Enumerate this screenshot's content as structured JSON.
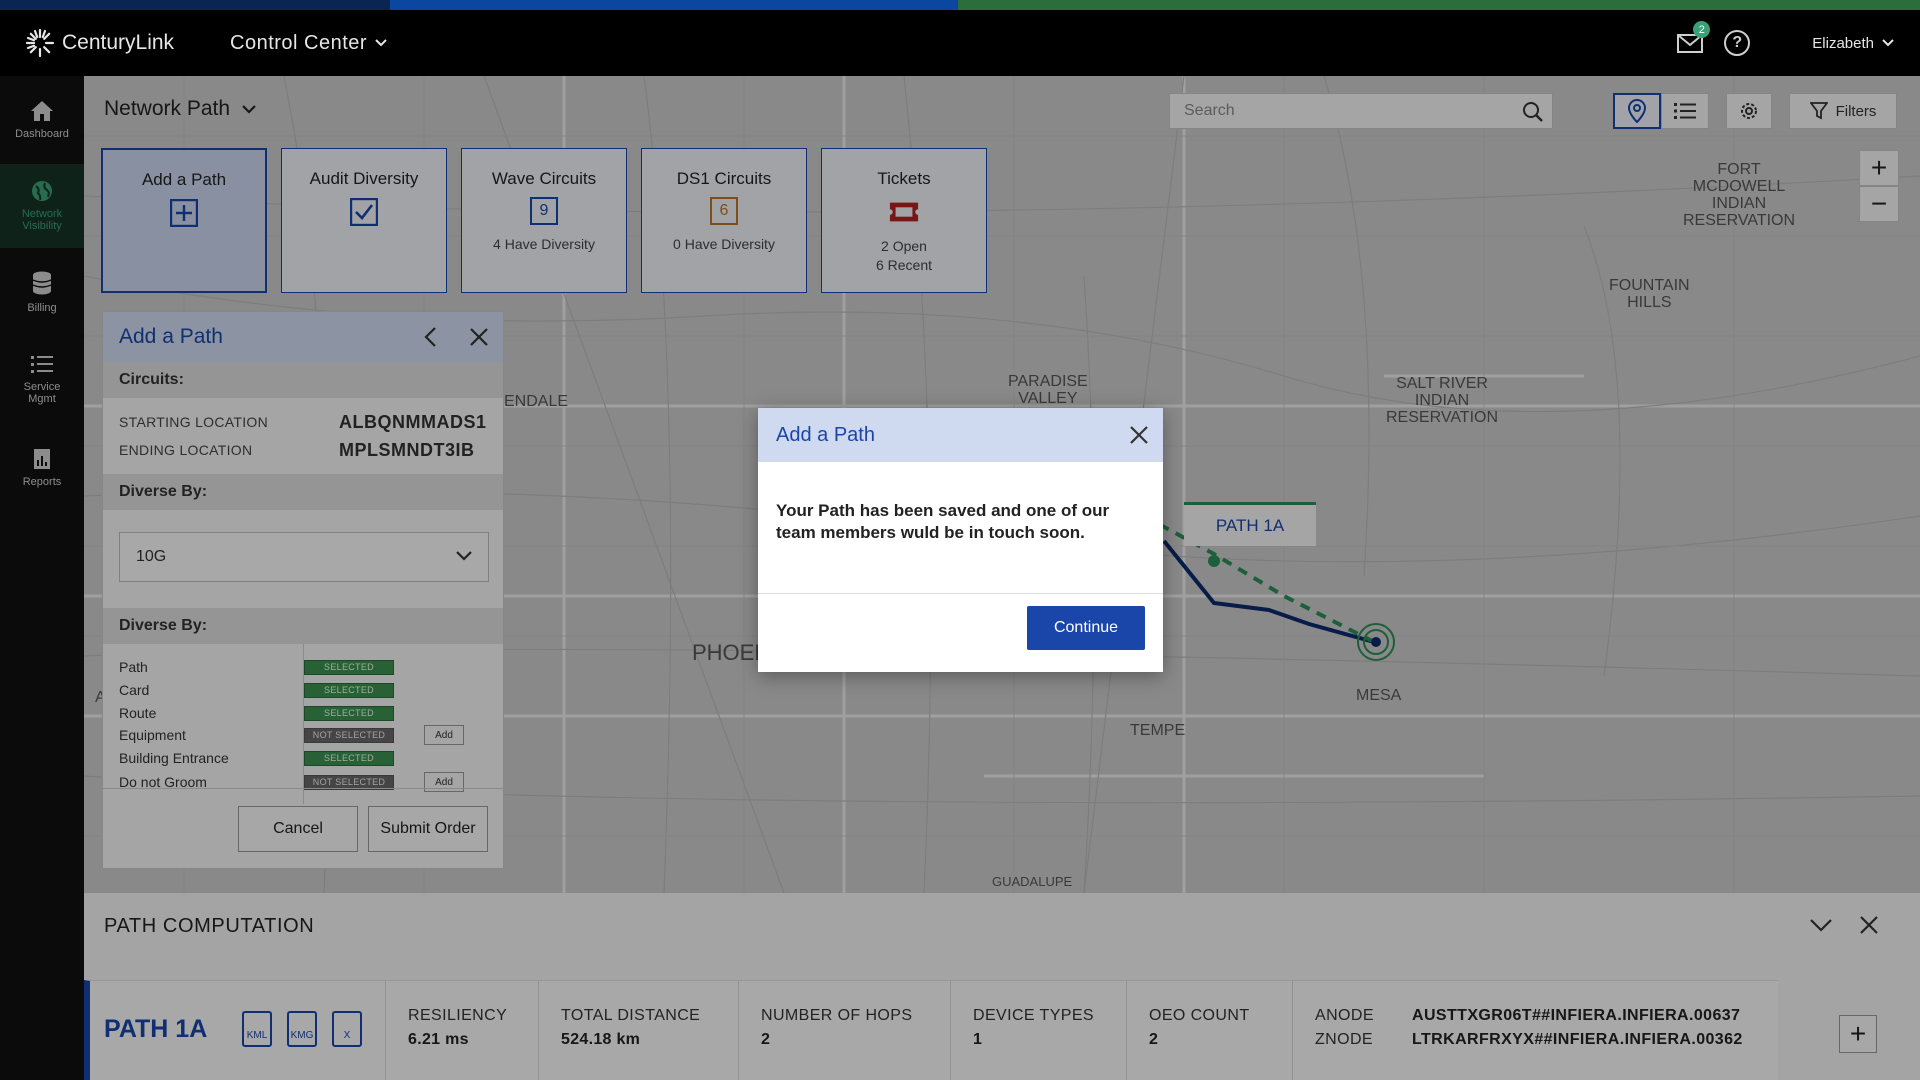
{
  "colors": {
    "brand_blue": "#1946a8",
    "brand_green": "#3aa077",
    "stripe_navy": "#0a2552",
    "stripe_blue": "#0b46a0",
    "stripe_green": "#2b6d3b"
  },
  "header": {
    "brand": "CenturyLink",
    "app_switcher": "Control Center",
    "mail_count": "2",
    "help_icon": "?",
    "user_name": "Elizabeth"
  },
  "sidenav": {
    "items": [
      {
        "label": "Dashboard",
        "icon": "home-icon"
      },
      {
        "label": "Network Visibility",
        "icon": "globe-icon"
      },
      {
        "label": "Billing",
        "icon": "coins-icon"
      },
      {
        "label": "Service Mgmt",
        "icon": "list-icon"
      },
      {
        "label": "Reports",
        "icon": "report-icon"
      }
    ]
  },
  "page": {
    "title": "Network Path",
    "search_placeholder": "Search",
    "filters_label": "Filters"
  },
  "tiles": [
    {
      "title": "Add a Path",
      "icon": "plus-box-icon",
      "sub": ""
    },
    {
      "title": "Audit Diversity",
      "icon": "checkbox-icon",
      "sub": ""
    },
    {
      "title": "Wave Circuits",
      "count": "9",
      "sub": "4 Have Diversity"
    },
    {
      "title": "DS1 Circuits",
      "count": "6",
      "sub": "0 Have Diversity"
    },
    {
      "title": "Tickets",
      "icon": "ticket-icon",
      "sub": "2 Open\n6 Recent"
    }
  ],
  "map": {
    "labels": {
      "fort": "FORT\nMCDOWELL\nINDIAN\nRESERVATION",
      "fountain": "FOUNTAIN\nHILLS",
      "salt_river": "SALT RIVER\nINDIAN\nRESERVATION",
      "paradise": "PARADISE\nVALLEY",
      "glendale": "ENDALE",
      "phoenix": "PHOEN",
      "tempe": "TEMPE",
      "mesa": "MESA",
      "guadalupe": "GUADALUPE",
      "edge_a": "A"
    },
    "path_label": "PATH 1A"
  },
  "panel": {
    "title": "Add a Path",
    "circuits_heading": "Circuits:",
    "start_label": "STARTING LOCATION",
    "start_value": "ALBQNMMADS1",
    "end_label": "ENDING LOCATION",
    "end_value": "MPLSMNDT3IB",
    "diverse_heading_1": "Diverse By:",
    "select_value": "10G",
    "diverse_heading_2": "Diverse By:",
    "options": [
      {
        "label": "Path",
        "status": "SELECTED",
        "add": ""
      },
      {
        "label": "Card",
        "status": "SELECTED",
        "add": ""
      },
      {
        "label": "Route",
        "status": "SELECTED",
        "add": ""
      },
      {
        "label": "Equipment",
        "status": "NOT SELECTED",
        "add": "Add"
      },
      {
        "label": "Building Entrance",
        "status": "SELECTED",
        "add": ""
      },
      {
        "label": "Do not Groom",
        "status": "NOT SELECTED",
        "add": "Add"
      }
    ],
    "cancel_label": "Cancel",
    "submit_label": "Submit Order"
  },
  "path_computation": {
    "title": "PATH COMPUTATION",
    "path_name": "PATH 1A",
    "file_types": [
      "KML",
      "KMG",
      "X"
    ],
    "resiliency_h": "RESILIENCY",
    "resiliency_v": "6.21 ms",
    "distance_h": "TOTAL DISTANCE",
    "distance_v": "524.18 km",
    "hops_h": "NUMBER OF HOPS",
    "hops_v": "2",
    "devices_h": "DEVICE TYPES",
    "devices_v": "1",
    "oeo_h": "OEO COUNT",
    "oeo_v": "2",
    "anode_h": "ANODE",
    "anode_v": "AUSTTXGR06T##INFIERA.INFIERA.00637",
    "znode_h": "ZNODE",
    "znode_v": "LTRKARFRXYX##INFIERA.INFIERA.00362",
    "plus": "+"
  },
  "modal": {
    "title": "Add a Path",
    "message": "Your Path has been saved and one of our team members wuld be in touch soon.",
    "continue_label": "Continue"
  }
}
